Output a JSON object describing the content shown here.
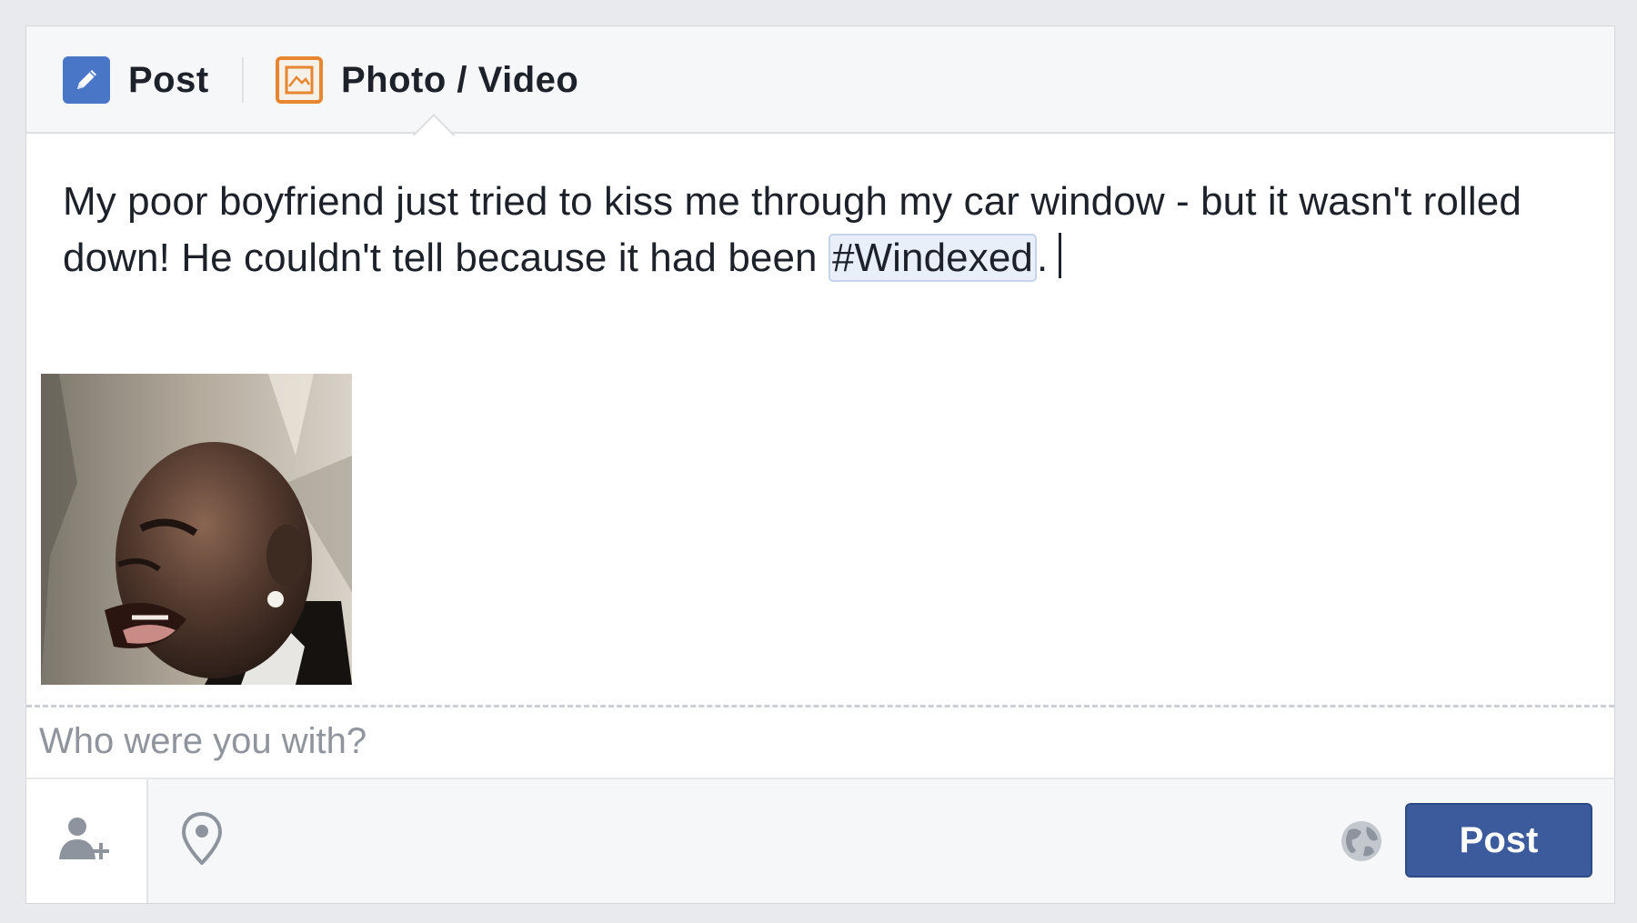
{
  "tabs": [
    {
      "label": "Post",
      "icon": "pencil-icon"
    },
    {
      "label": "Photo / Video",
      "icon": "photo-icon"
    }
  ],
  "post": {
    "text_before": "My poor boyfriend just tried to kiss me through my car window - but it wasn't rolled down! He couldn't tell because it had been ",
    "hashtag": "#Windexed",
    "text_after": "."
  },
  "attachment": {
    "type": "photo",
    "description_icon": "person-photo-thumbnail"
  },
  "who_with": {
    "placeholder": "Who were you with?"
  },
  "footer": {
    "tag_people_icon": "add-friend-icon",
    "location_icon": "location-pin-icon",
    "privacy_icon": "globe-icon",
    "post_button_label": "Post"
  },
  "colors": {
    "accent": "#3c5b9c",
    "pencil_icon_bg": "#4a76c8",
    "photo_icon_border": "#e8852f",
    "hashtag_bg": "#e9eff9"
  }
}
